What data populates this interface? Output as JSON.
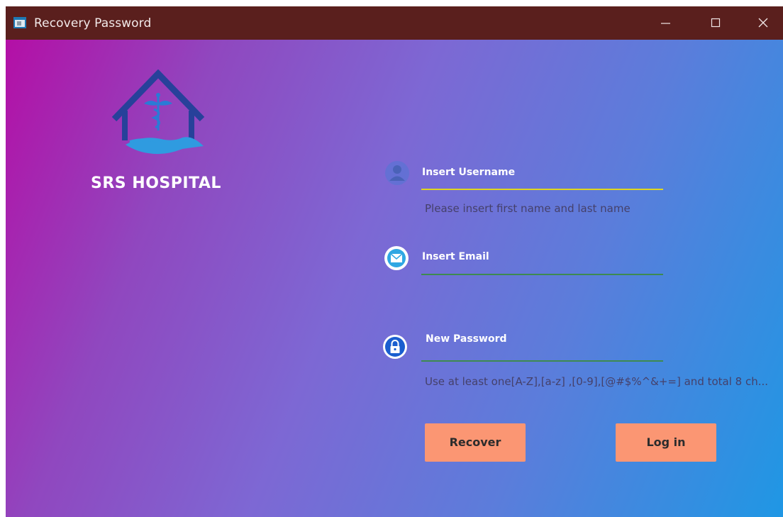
{
  "window": {
    "title": "Recovery Password"
  },
  "brand": {
    "name": "SRS HOSPITAL"
  },
  "form": {
    "username": {
      "label": "Insert Username",
      "hint": "Please insert first name and last name",
      "icon": "user-icon",
      "underline_color": "#e0d61f"
    },
    "email": {
      "label": "Insert Email",
      "icon": "envelope-icon",
      "underline_color": "#3e8a4f"
    },
    "password": {
      "label": "New Password",
      "hint": "Use at least one[A-Z],[a-z] ,[0-9],[@#$%^&+=] and total 8 ch...",
      "icon": "lock-icon",
      "underline_color": "#3e8a4f"
    }
  },
  "buttons": {
    "recover": "Recover",
    "login": "Log in"
  },
  "colors": {
    "titlebar": "#5a1f1d",
    "button": "#fb9673",
    "gradient_start": "#b40fa6",
    "gradient_end": "#1f97e4"
  }
}
